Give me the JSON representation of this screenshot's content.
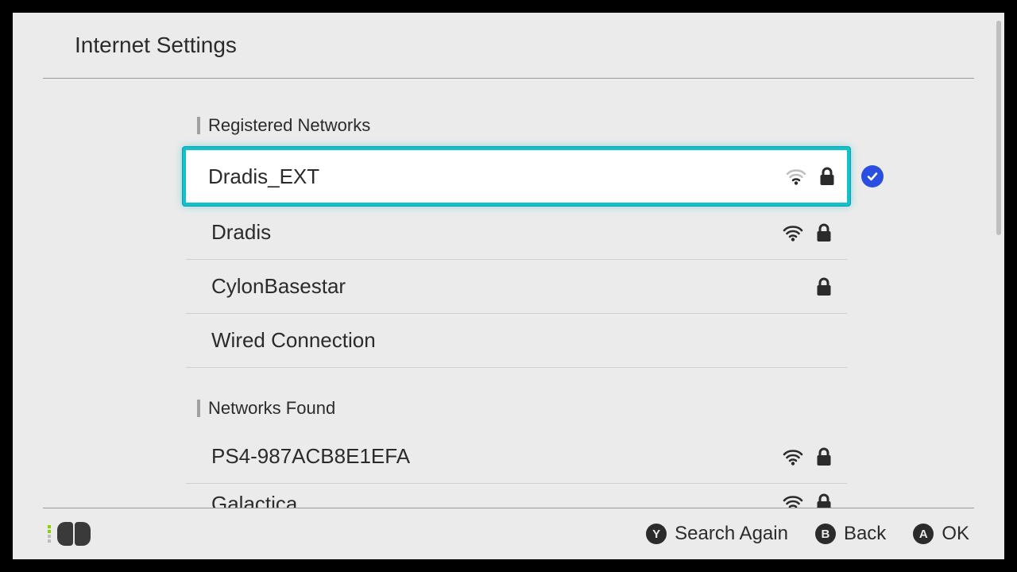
{
  "header": {
    "title": "Internet Settings"
  },
  "sections": {
    "registered": {
      "label": "Registered Networks",
      "items": [
        {
          "ssid": "Dradis_EXT",
          "signal": 1,
          "locked": true,
          "focused": true,
          "connected": true
        },
        {
          "ssid": "Dradis",
          "signal": 3,
          "locked": true
        },
        {
          "ssid": "CylonBasestar",
          "signal": 0,
          "locked": true
        },
        {
          "ssid": "Wired Connection",
          "signal": 0,
          "locked": false
        }
      ]
    },
    "found": {
      "label": "Networks Found",
      "items": [
        {
          "ssid": "PS4-987ACB8E1EFA",
          "signal": 3,
          "locked": true
        },
        {
          "ssid": "Galactica",
          "signal": 3,
          "locked": true
        }
      ]
    }
  },
  "footer": {
    "y_label": "Search Again",
    "b_label": "Back",
    "a_label": "OK"
  }
}
